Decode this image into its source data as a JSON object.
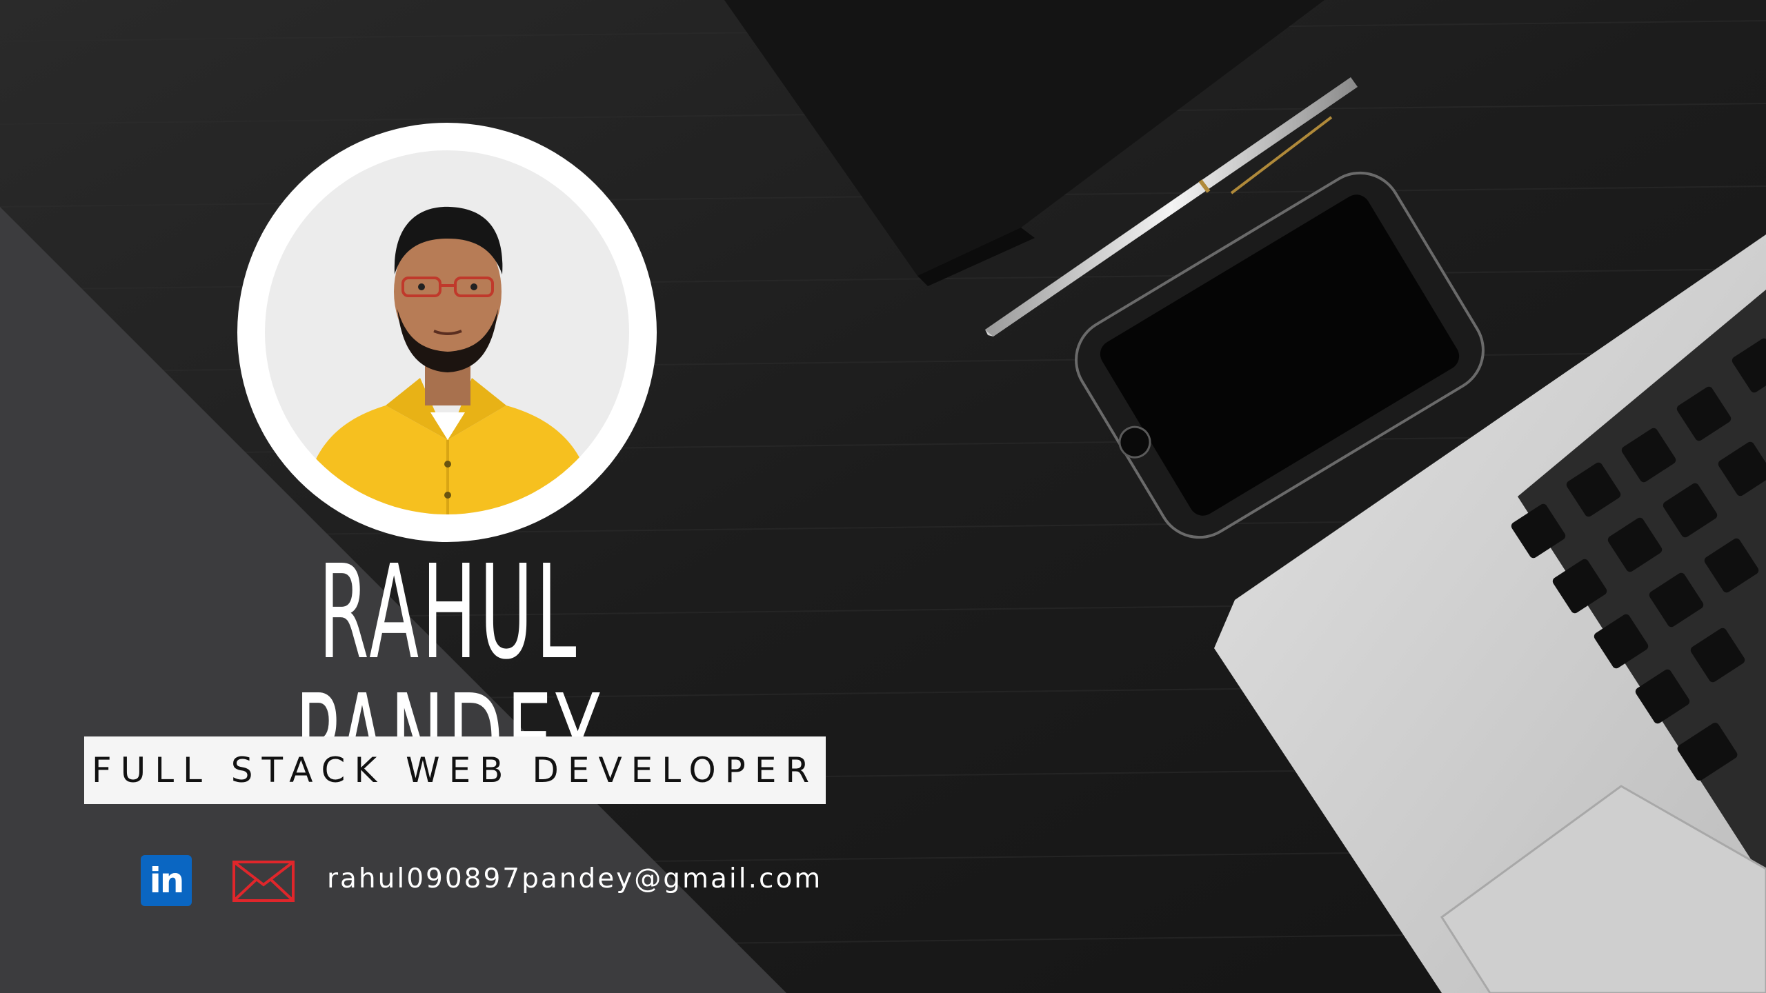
{
  "profile": {
    "name": "RAHUL PANDEY",
    "role": "FULL STACK WEB DEVELOPER",
    "email": "rahul090897pandey@gmail.com"
  },
  "icons": {
    "linkedin": "linkedin-icon",
    "mail": "mail-icon",
    "linkedin_glyph": "in"
  },
  "colors": {
    "background": "#1f1f1f",
    "linkedin_blue": "#0a66c2",
    "mail_red": "#e0262b",
    "shirt_yellow": "#f6c01f"
  }
}
